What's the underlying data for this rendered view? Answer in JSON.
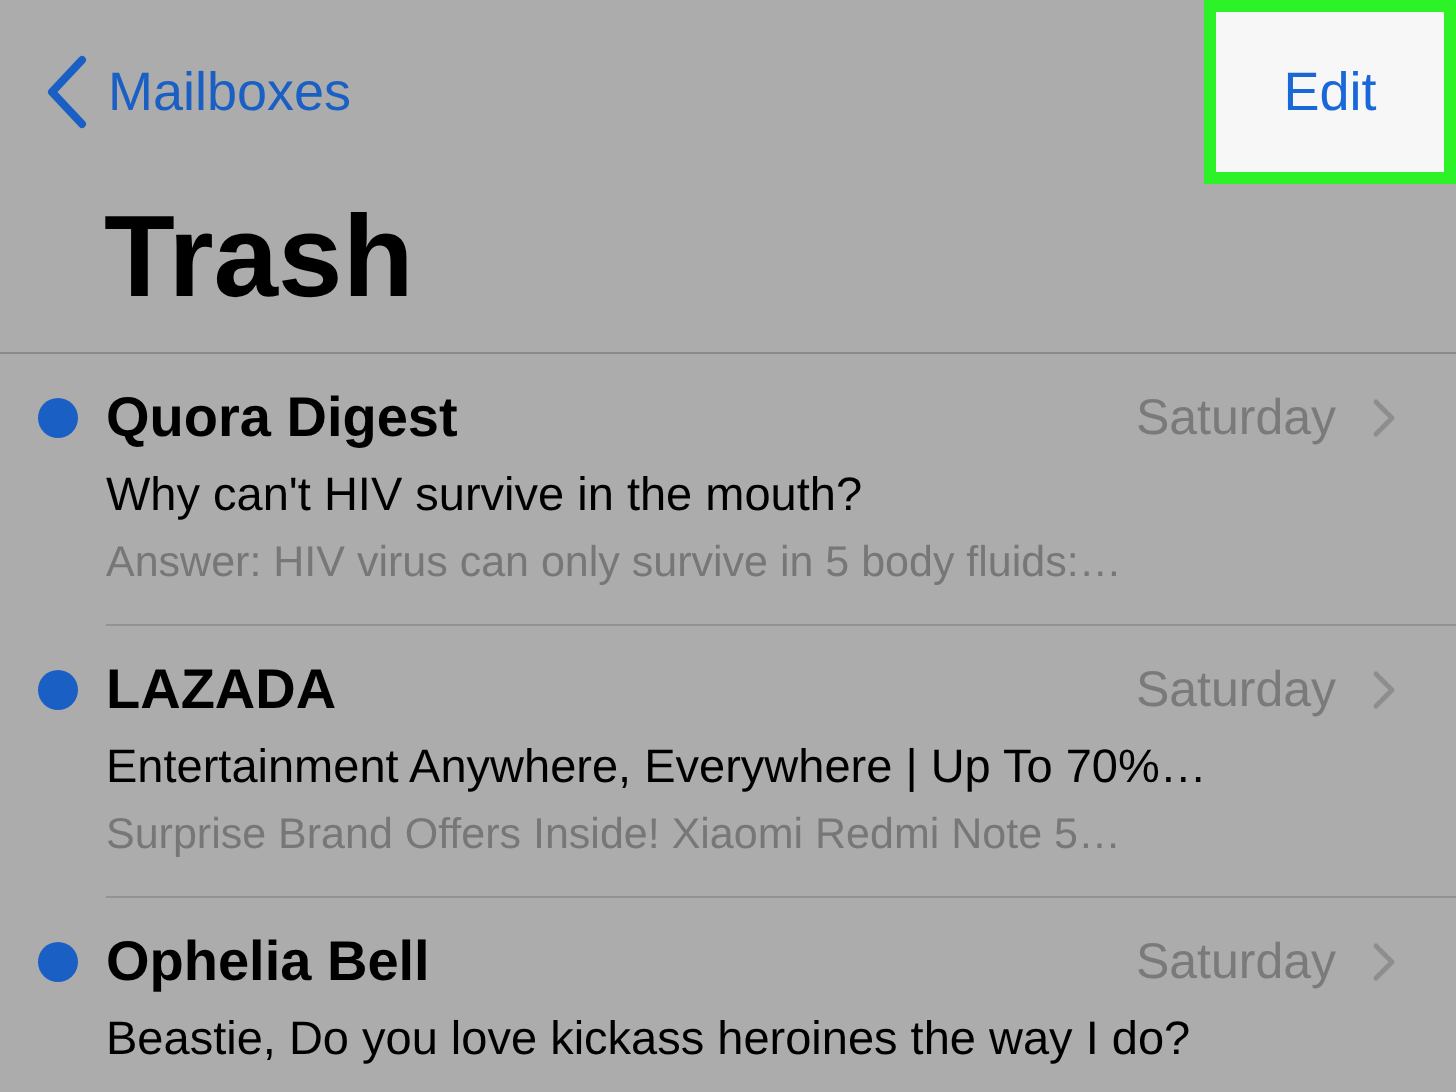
{
  "nav": {
    "back_label": "Mailboxes",
    "edit_button": {
      "label": "Edit",
      "highlighted": true
    }
  },
  "title": "Trash",
  "messages": [
    {
      "sender": "Quora Digest",
      "date": "Saturday",
      "subject": "Why can't HIV survive in the mouth?",
      "preview": "Answer: HIV virus can only survive in 5 body fluids:…",
      "unread": true
    },
    {
      "sender": "LAZADA",
      "date": "Saturday",
      "subject": "Entertainment Anywhere, Everywhere | Up To 70%…",
      "preview": "Surprise Brand Offers Inside! Xiaomi Redmi Note 5…",
      "unread": true
    },
    {
      "sender": "Ophelia Bell",
      "date": "Saturday",
      "subject": "Beastie, Do you love kickass heroines the way I do?",
      "unread": true
    }
  ]
}
